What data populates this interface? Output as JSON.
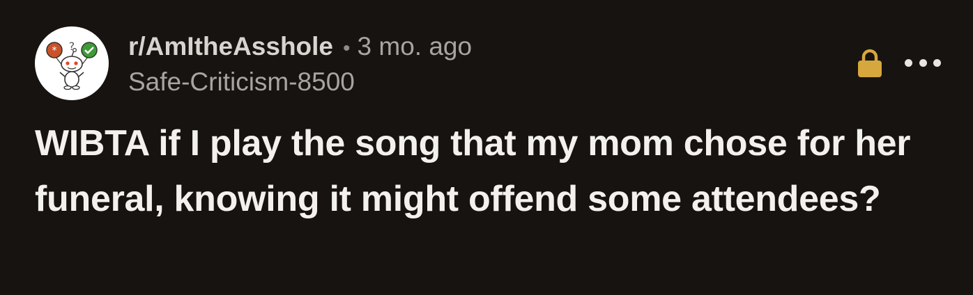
{
  "post": {
    "subreddit": "r/AmItheAsshole",
    "separator": "•",
    "age": "3 mo. ago",
    "username": "Safe-Criticism-8500",
    "title": "WIBTA if I play the song that my mom chose for her funeral, knowing it might offend some attendees?"
  },
  "icons": {
    "avatar": "reddit-snoo-avatar-icon",
    "lock": "lock-icon",
    "more": "more-options-icon"
  },
  "colors": {
    "background": "#161310",
    "lock": "#d6a73c",
    "title": "#f3f1ee",
    "secondary_text": "#a9a4a0"
  }
}
